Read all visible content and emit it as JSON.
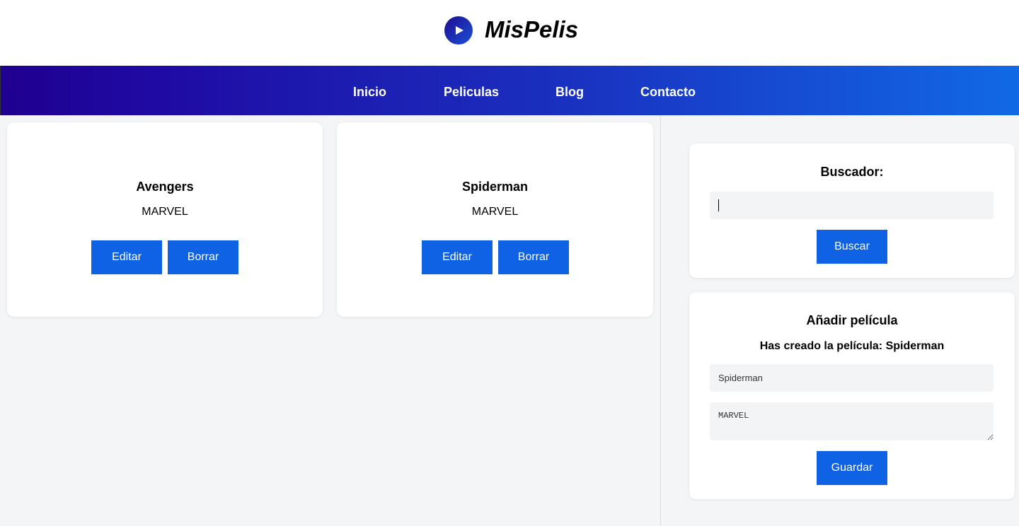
{
  "brand": {
    "name": "MisPelis",
    "logo_icon": "play-icon"
  },
  "nav": {
    "items": [
      {
        "label": "Inicio"
      },
      {
        "label": "Peliculas"
      },
      {
        "label": "Blog"
      },
      {
        "label": "Contacto"
      }
    ]
  },
  "movies": [
    {
      "title": "Avengers",
      "description": "MARVEL",
      "edit_label": "Editar",
      "delete_label": "Borrar"
    },
    {
      "title": "Spiderman",
      "description": "MARVEL",
      "edit_label": "Editar",
      "delete_label": "Borrar"
    }
  ],
  "search": {
    "heading": "Buscador:",
    "value": "",
    "button_label": "Buscar"
  },
  "add_movie": {
    "heading": "Añadir película",
    "message": "Has creado la película: Spiderman",
    "title_value": "Spiderman",
    "description_value": "MARVEL",
    "save_label": "Guardar"
  },
  "colors": {
    "accent": "#0f62e3",
    "nav_gradient_start": "#1f0090",
    "nav_gradient_end": "#1169e6",
    "background": "#f4f5f7"
  }
}
